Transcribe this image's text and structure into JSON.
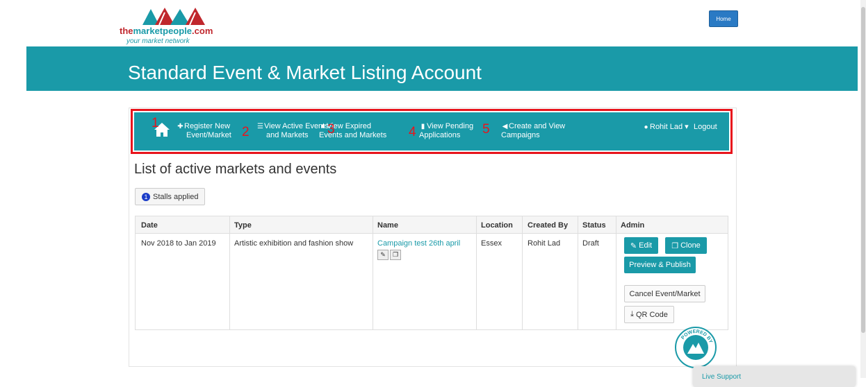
{
  "header": {
    "logo_name": "themarketpeople.com",
    "logo_name_part1": "the",
    "logo_name_part2": "marketpeople",
    "logo_name_part3": ".com",
    "logo_tagline": "your market network",
    "home_label": "Home"
  },
  "banner": {
    "title": "Standard Event & Market Listing Account"
  },
  "nav": {
    "items": [
      {
        "line1": "Register New",
        "line2": "Event/Market",
        "icon": "plus-icon"
      },
      {
        "line1": "View Active Events",
        "line2": "and Markets",
        "icon": "list-icon"
      },
      {
        "line1": "View Expired",
        "line2": "Events and Markets",
        "icon": "briefcase-icon"
      },
      {
        "line1": "View Pending",
        "line2": "Applications",
        "icon": "file-icon"
      },
      {
        "line1": "Create and View",
        "line2": "Campaigns",
        "icon": "megaphone-icon"
      }
    ],
    "user": "Rohit Lad",
    "logout": "Logout",
    "annotations": [
      "1",
      "2",
      "3",
      "4",
      "5"
    ]
  },
  "list": {
    "title": "List of active markets and events",
    "stalls_count": "1",
    "stalls_label": "Stalls applied"
  },
  "table": {
    "headers": [
      "Date",
      "Type",
      "Name",
      "Location",
      "Created By",
      "Status",
      "Admin"
    ],
    "row": {
      "date": "Nov 2018 to Jan 2019",
      "type": "Artistic exhibition and fashion show",
      "name": "Campaign test 26th april",
      "location": "Essex",
      "created_by": "Rohit Lad",
      "status": "Draft"
    },
    "actions": {
      "edit": "Edit",
      "clone": "Clone",
      "preview": "Preview & Publish",
      "cancel": "Cancel Event/Market",
      "qr": "QR Code"
    }
  },
  "powered_by": "POWERED BY",
  "live_support": "Live Support",
  "colors": {
    "teal": "#1a9aa8",
    "annotation_red": "#e8141c",
    "home_blue": "#2a7ac4"
  }
}
